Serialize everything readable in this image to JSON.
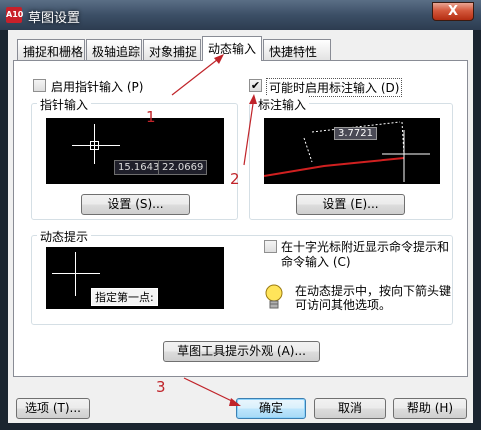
{
  "window": {
    "title": "草图设置",
    "close_glyph": "X",
    "app_icon_text": "A10"
  },
  "tabs": [
    {
      "label": "捕捉和栅格",
      "active": false
    },
    {
      "label": "极轴追踪",
      "active": false
    },
    {
      "label": "对象捕捉",
      "active": false
    },
    {
      "label": "动态输入",
      "active": true
    },
    {
      "label": "快捷特性",
      "active": false
    }
  ],
  "pointer_input": {
    "checkbox_label": "启用指针输入 (P)",
    "checked": false,
    "group_title": "指针输入",
    "coord_x": "15.1643",
    "coord_y": "22.0669",
    "settings_button": "设置 (S)..."
  },
  "dimension_input": {
    "checkbox_label": "可能时启用标注输入 (D)",
    "checked": true,
    "check_glyph": "✔",
    "group_title": "标注输入",
    "dim_value": "3.7721",
    "settings_button": "设置 (E)..."
  },
  "dynamic_prompt": {
    "group_title": "动态提示",
    "prompt_text": "指定第一点:",
    "checkbox_label_line1": "在十字光标附近显示命令提示和",
    "checkbox_label_line2": "命令输入 (C)",
    "checked": false,
    "info_line1": "在动态提示中，按向下箭头键",
    "info_line2": "可访问其他选项。"
  },
  "tooltip_button": "草图工具提示外观 (A)...",
  "footer": {
    "options_button": "选项 (T)...",
    "ok_button": "确定",
    "cancel_button": "取消",
    "help_button": "帮助 (H)"
  },
  "annotations": {
    "step1": "1",
    "step2": "2",
    "step3": "3",
    "color": "#c0242a"
  },
  "colors": {
    "preview_bg": "#000000",
    "accent_red": "#d02020",
    "dialog_bg": "#f0f0f0"
  }
}
